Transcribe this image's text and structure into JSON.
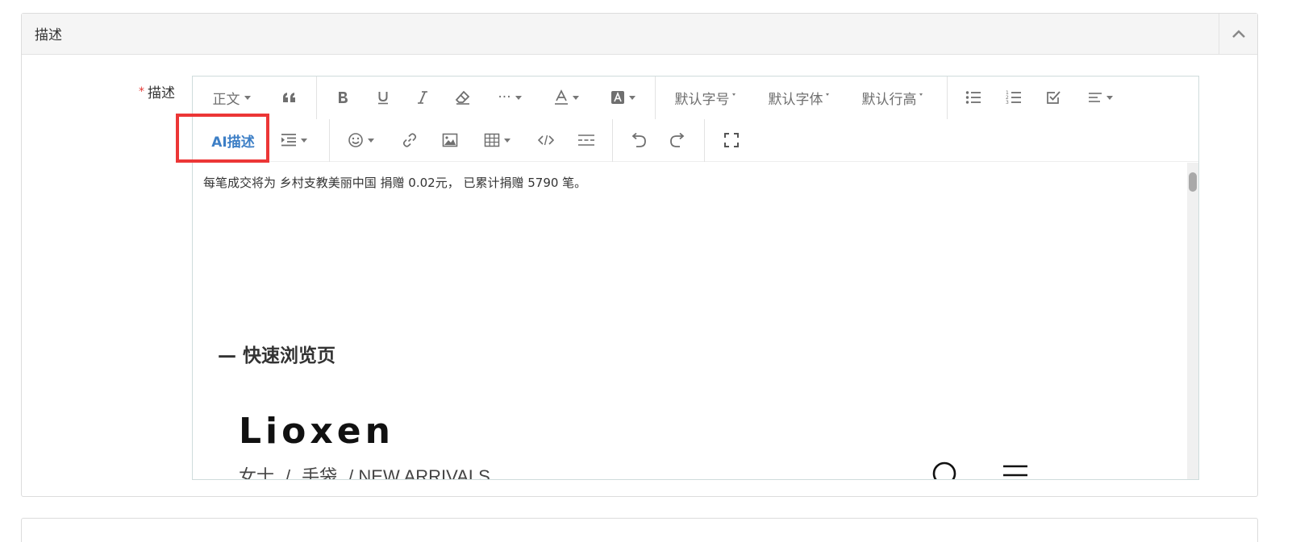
{
  "panel": {
    "title": "描述"
  },
  "field": {
    "required_mark": "*",
    "label": "描述"
  },
  "toolbar": {
    "paragraph": "正文",
    "font_size": "默认字号",
    "font_family": "默认字体",
    "line_height": "默认行高",
    "ai_button": "AI描述",
    "more": "···"
  },
  "content": {
    "intro": "每笔成交将为 乡村支教美丽中国 捐赠 0.02元， 已累计捐赠 5790 笔。",
    "section_heading": "— 快速浏览页",
    "brand": "Lioxen",
    "breadcrumb": [
      "女士",
      "/",
      "手袋",
      "/ NEW ARRIVALS"
    ]
  },
  "colors": {
    "accent": "#3d7fc6",
    "highlight": "#ec3636",
    "required": "#e53935",
    "image_block": "#d6d1d2"
  },
  "icons": [
    "quote-icon",
    "bold-icon",
    "underline-icon",
    "italic-icon",
    "eraser-icon",
    "font-color-icon",
    "background-color-icon",
    "bullet-list-icon",
    "numbered-list-icon",
    "todo-icon",
    "align-icon",
    "indent-icon",
    "emoji-icon",
    "link-icon",
    "image-icon",
    "table-icon",
    "code-icon",
    "divider-icon",
    "undo-icon",
    "redo-icon",
    "fullscreen-icon",
    "search-icon",
    "menu-icon",
    "chevron-up-icon"
  ]
}
